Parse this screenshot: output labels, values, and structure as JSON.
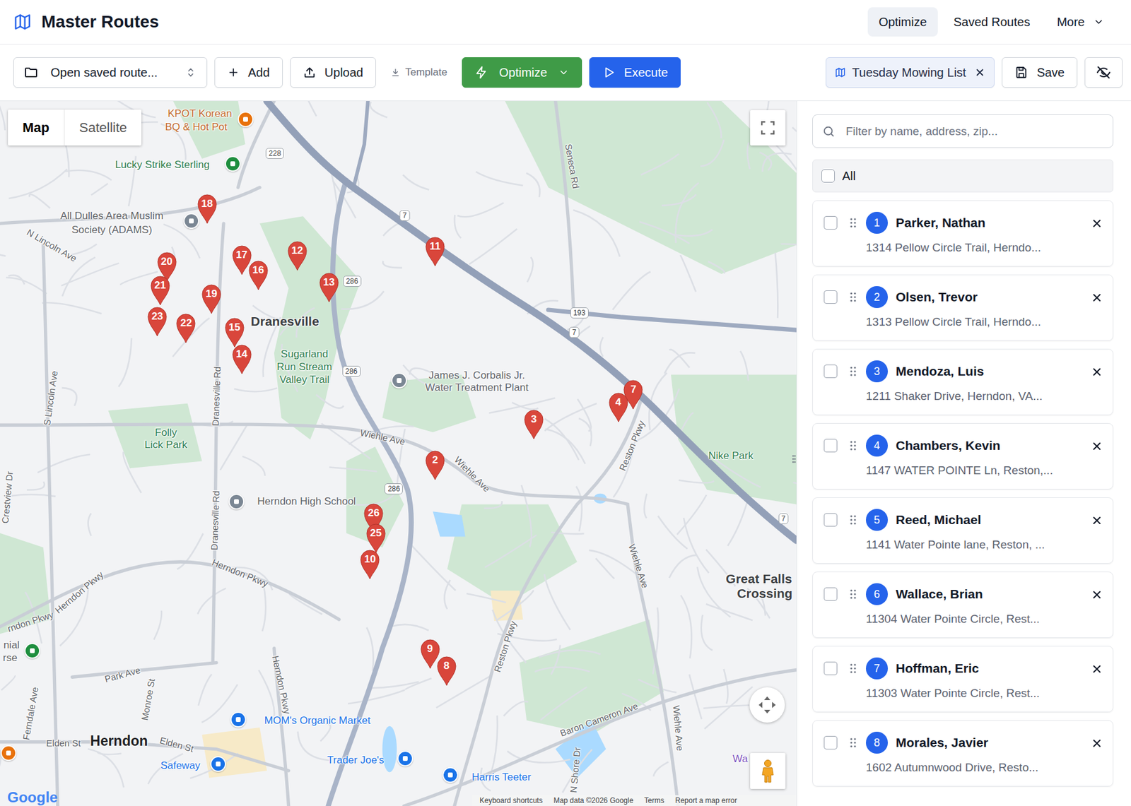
{
  "app": {
    "title": "Master Routes"
  },
  "nav": [
    {
      "label": "Optimize",
      "selected": true,
      "kind": "link"
    },
    {
      "label": "Saved Routes",
      "selected": false,
      "kind": "link"
    },
    {
      "label": "More",
      "selected": false,
      "kind": "menu"
    }
  ],
  "toolbar": {
    "open_saved": "Open saved route...",
    "add": "Add",
    "upload": "Upload",
    "template": "Template",
    "optimize": "Optimize",
    "execute": "Execute",
    "route_name": "Tuesday Mowing List",
    "save": "Save"
  },
  "map": {
    "view_toggle": [
      {
        "label": "Map",
        "selected": true
      },
      {
        "label": "Satellite",
        "selected": false
      }
    ],
    "labels": [
      {
        "text": "KPOT Korean",
        "kind": "food"
      },
      {
        "text": "BQ & Hot Pot",
        "kind": "food"
      },
      {
        "text": "Lucky Strike Sterling",
        "kind": "place"
      },
      {
        "text": "All Dulles Area Muslim",
        "kind": "civic"
      },
      {
        "text": "Society (ADAMS)",
        "kind": "civic"
      },
      {
        "text": "N Lincoln Ave",
        "kind": "road"
      },
      {
        "text": "Dranesville",
        "kind": "town"
      },
      {
        "text": "Sugarland",
        "kind": "place"
      },
      {
        "text": "Run Stream",
        "kind": "place"
      },
      {
        "text": "Valley Trail",
        "kind": "place"
      },
      {
        "text": "James J. Corbalis Jr.",
        "kind": "civic"
      },
      {
        "text": "Water Treatment Plant",
        "kind": "civic"
      },
      {
        "text": "Folly",
        "kind": "place"
      },
      {
        "text": "Lick Park",
        "kind": "place"
      },
      {
        "text": "Wiehle Ave",
        "kind": "road"
      },
      {
        "text": "Wiehle Ave",
        "kind": "road"
      },
      {
        "text": "Wiehle Ave",
        "kind": "road"
      },
      {
        "text": "Wiehle Ave",
        "kind": "road"
      },
      {
        "text": "Herndon High School",
        "kind": "civic"
      },
      {
        "text": "Herndon Pkwy",
        "kind": "road"
      },
      {
        "text": "Herndon Pkwy",
        "kind": "road"
      },
      {
        "text": "Herndon Pkwy",
        "kind": "road"
      },
      {
        "text": "rndon Pkwy",
        "kind": "road"
      },
      {
        "text": "Dranesville Rd",
        "kind": "road"
      },
      {
        "text": "Dranesville Rd",
        "kind": "road"
      },
      {
        "text": "S Lincoln Ave",
        "kind": "road"
      },
      {
        "text": "Crestview Dr",
        "kind": "road"
      },
      {
        "text": "Seneca Rd",
        "kind": "road"
      },
      {
        "text": "Reston Pkwy",
        "kind": "road"
      },
      {
        "text": "Reston Pkwy",
        "kind": "road"
      },
      {
        "text": "Nike Park",
        "kind": "place"
      },
      {
        "text": "Great Falls",
        "kind": "area"
      },
      {
        "text": "Crossing",
        "kind": "area"
      },
      {
        "text": "Baron Cameron Ave",
        "kind": "road"
      },
      {
        "text": "MOM's Organic Market",
        "kind": "shop"
      },
      {
        "text": "Trader Joe's",
        "kind": "shop"
      },
      {
        "text": "Harris Teeter",
        "kind": "shop"
      },
      {
        "text": "Safeway",
        "kind": "shop"
      },
      {
        "text": "Herndon",
        "kind": "city"
      },
      {
        "text": "Elden St",
        "kind": "road"
      },
      {
        "text": "Elden St",
        "kind": "road"
      },
      {
        "text": "Park Ave",
        "kind": "road"
      },
      {
        "text": "Monroe St",
        "kind": "road"
      },
      {
        "text": "Ferndale Ave",
        "kind": "road"
      },
      {
        "text": "N Shore Dr",
        "kind": "road"
      },
      {
        "text": "nial",
        "kind": "civic"
      },
      {
        "text": "rse",
        "kind": "civic"
      },
      {
        "text": "Wa",
        "kind": "venue"
      }
    ],
    "shields": [
      "228",
      "7",
      "286",
      "286",
      "286",
      "193",
      "7",
      "7"
    ],
    "pins": [
      {
        "label": "11"
      },
      {
        "label": "12"
      },
      {
        "label": "13"
      },
      {
        "label": "14"
      },
      {
        "label": "15"
      },
      {
        "label": "16"
      },
      {
        "label": "17"
      },
      {
        "label": "18"
      },
      {
        "label": "19"
      },
      {
        "label": "20"
      },
      {
        "label": "21"
      },
      {
        "label": "22"
      },
      {
        "label": "23"
      },
      {
        "label": "26"
      },
      {
        "label": "25"
      },
      {
        "label": "10"
      },
      {
        "label": "2"
      },
      {
        "label": "3"
      },
      {
        "label": "7"
      },
      {
        "label": "4"
      },
      {
        "label": "9"
      },
      {
        "label": "8"
      }
    ],
    "footer": {
      "logo": "Google",
      "links": [
        "Keyboard shortcuts",
        "Map data ©2026 Google",
        "Terms",
        "Report a map error"
      ]
    }
  },
  "panel": {
    "filter_placeholder": "Filter by name, address, zip...",
    "all": {
      "label": "All",
      "checked": false
    },
    "stops": [
      {
        "number": "1",
        "name": "Parker, Nathan",
        "address": "1314 Pellow Circle Trail, Herndo...",
        "checked": false
      },
      {
        "number": "2",
        "name": "Olsen, Trevor",
        "address": "1313 Pellow Circle Trail, Herndo...",
        "checked": false
      },
      {
        "number": "3",
        "name": "Mendoza, Luis",
        "address": "1211 Shaker Drive, Herndon, VA...",
        "checked": false
      },
      {
        "number": "4",
        "name": "Chambers, Kevin",
        "address": "1147 WATER POINTE Ln, Reston,...",
        "checked": false
      },
      {
        "number": "5",
        "name": "Reed, Michael",
        "address": "1141 Water Pointe lane, Reston, ...",
        "checked": false
      },
      {
        "number": "6",
        "name": "Wallace, Brian",
        "address": "11304 Water Pointe Circle, Rest...",
        "checked": false
      },
      {
        "number": "7",
        "name": "Hoffman, Eric",
        "address": "11303 Water Pointe Circle, Rest...",
        "checked": false
      },
      {
        "number": "8",
        "name": "Morales, Javier",
        "address": "1602 Autumnwood Drive, Resto...",
        "checked": false
      }
    ]
  }
}
